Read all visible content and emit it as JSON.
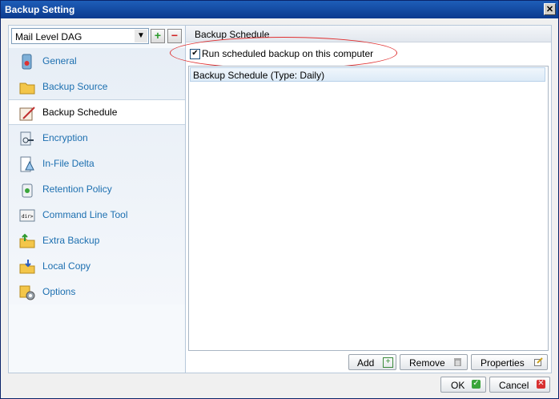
{
  "window": {
    "title": "Backup Setting",
    "close_glyph": "✕"
  },
  "profile": {
    "selected": "Mail Level DAG",
    "add_glyph": "+",
    "remove_glyph": "−"
  },
  "nav": {
    "items": [
      {
        "label": "General",
        "icon": "general-icon"
      },
      {
        "label": "Backup Source",
        "icon": "folder-icon"
      },
      {
        "label": "Backup Schedule",
        "icon": "calendar-icon",
        "active": true
      },
      {
        "label": "Encryption",
        "icon": "key-icon"
      },
      {
        "label": "In-File Delta",
        "icon": "delta-icon"
      },
      {
        "label": "Retention Policy",
        "icon": "recycle-icon"
      },
      {
        "label": "Command Line Tool",
        "icon": "terminal-icon",
        "icon_text": "dir>"
      },
      {
        "label": "Extra Backup",
        "icon": "extra-backup-icon"
      },
      {
        "label": "Local Copy",
        "icon": "local-copy-icon"
      },
      {
        "label": "Options",
        "icon": "options-icon"
      }
    ]
  },
  "main": {
    "section_title": "Backup Schedule",
    "run_scheduled_label": "Run scheduled backup on this computer",
    "run_scheduled_checked": true,
    "schedules": [
      {
        "label": "Backup Schedule (Type: Daily)"
      }
    ],
    "buttons": {
      "add": "Add",
      "remove": "Remove",
      "properties": "Properties"
    }
  },
  "footer": {
    "ok": "OK",
    "cancel": "Cancel"
  },
  "colors": {
    "accent": "#1c6fb0",
    "highlight_ring": "#e03030",
    "titlebar": "#0b3a8e"
  }
}
